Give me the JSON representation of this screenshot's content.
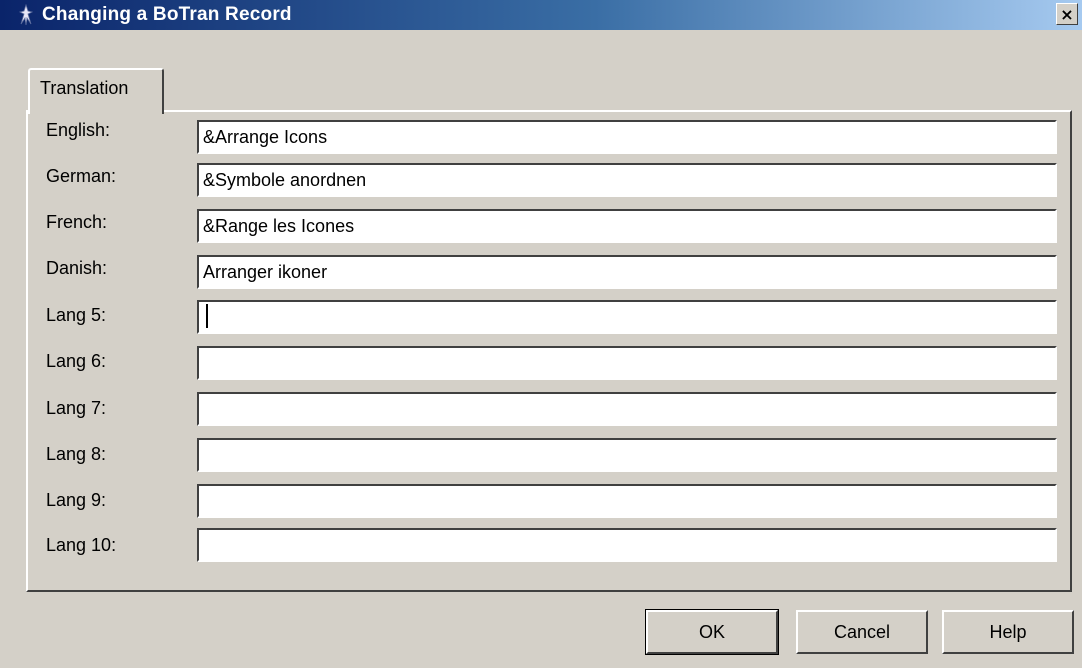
{
  "window": {
    "title": "Changing a BoTran Record",
    "close_label": "×",
    "icon": "app-figure-icon"
  },
  "tabs": [
    {
      "label": "Translation",
      "active": true
    }
  ],
  "rows": [
    {
      "label": "English:",
      "value": "&Arrange Icons"
    },
    {
      "label": "German:",
      "value": "&Symbole anordnen"
    },
    {
      "label": "French:",
      "value": "&Range les Icones"
    },
    {
      "label": "Danish:",
      "value": "Arranger ikoner"
    },
    {
      "label": "Lang 5:",
      "value": ""
    },
    {
      "label": "Lang 6:",
      "value": ""
    },
    {
      "label": "Lang 7:",
      "value": ""
    },
    {
      "label": "Lang 8:",
      "value": ""
    },
    {
      "label": "Lang 9:",
      "value": ""
    },
    {
      "label": "Lang 10:",
      "value": ""
    }
  ],
  "buttons": {
    "ok": "OK",
    "cancel": "Cancel",
    "help": "Help"
  },
  "colors": {
    "titlebar_start": "#0a246a",
    "titlebar_end": "#a6caf0",
    "face": "#d4d0c8"
  }
}
